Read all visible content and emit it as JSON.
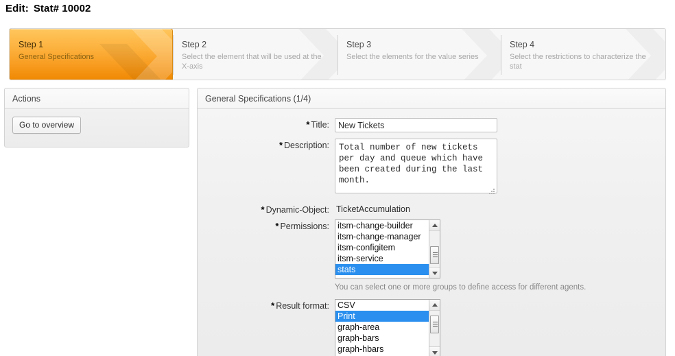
{
  "page": {
    "title_label": "Edit:",
    "title_value": "Stat# 10002"
  },
  "steps": [
    {
      "title": "Step 1",
      "desc": "General Specifications",
      "active": true
    },
    {
      "title": "Step 2",
      "desc": "Select the element that will be used at the X-axis",
      "active": false
    },
    {
      "title": "Step 3",
      "desc": "Select the elements for the value series",
      "active": false
    },
    {
      "title": "Step 4",
      "desc": "Select the restrictions to characterize the stat",
      "active": false
    }
  ],
  "actions": {
    "header": "Actions",
    "go_to_overview": "Go to overview"
  },
  "content": {
    "header": "General Specifications (1/4)",
    "fields": {
      "title": {
        "label": "Title:",
        "required_marker": "*",
        "value": "New Tickets"
      },
      "description": {
        "label": "Description:",
        "required_marker": "*",
        "value": "Total number of new tickets per day and queue which have been created during the last month."
      },
      "dynamic_object": {
        "label": "Dynamic-Object:",
        "required_marker": "*",
        "value": "TicketAccumulation"
      },
      "permissions": {
        "label": "Permissions:",
        "required_marker": "*",
        "options": [
          {
            "label": "itsm-change-builder",
            "selected": false
          },
          {
            "label": "itsm-change-manager",
            "selected": false
          },
          {
            "label": "itsm-configitem",
            "selected": false
          },
          {
            "label": "itsm-service",
            "selected": false
          },
          {
            "label": "stats",
            "selected": true
          }
        ],
        "hint": "You can select one or more groups to define access for different agents."
      },
      "result_format": {
        "label": "Result format:",
        "required_marker": "*",
        "options": [
          {
            "label": "CSV",
            "selected": false
          },
          {
            "label": "Print",
            "selected": true
          },
          {
            "label": "graph-area",
            "selected": false
          },
          {
            "label": "graph-bars",
            "selected": false
          },
          {
            "label": "graph-hbars",
            "selected": false
          }
        ]
      }
    }
  },
  "colors": {
    "accent_orange": "#f79a1d",
    "selection_blue": "#2a8fee",
    "panel_bg": "#f0f0f0",
    "border": "#d3d3d3"
  }
}
